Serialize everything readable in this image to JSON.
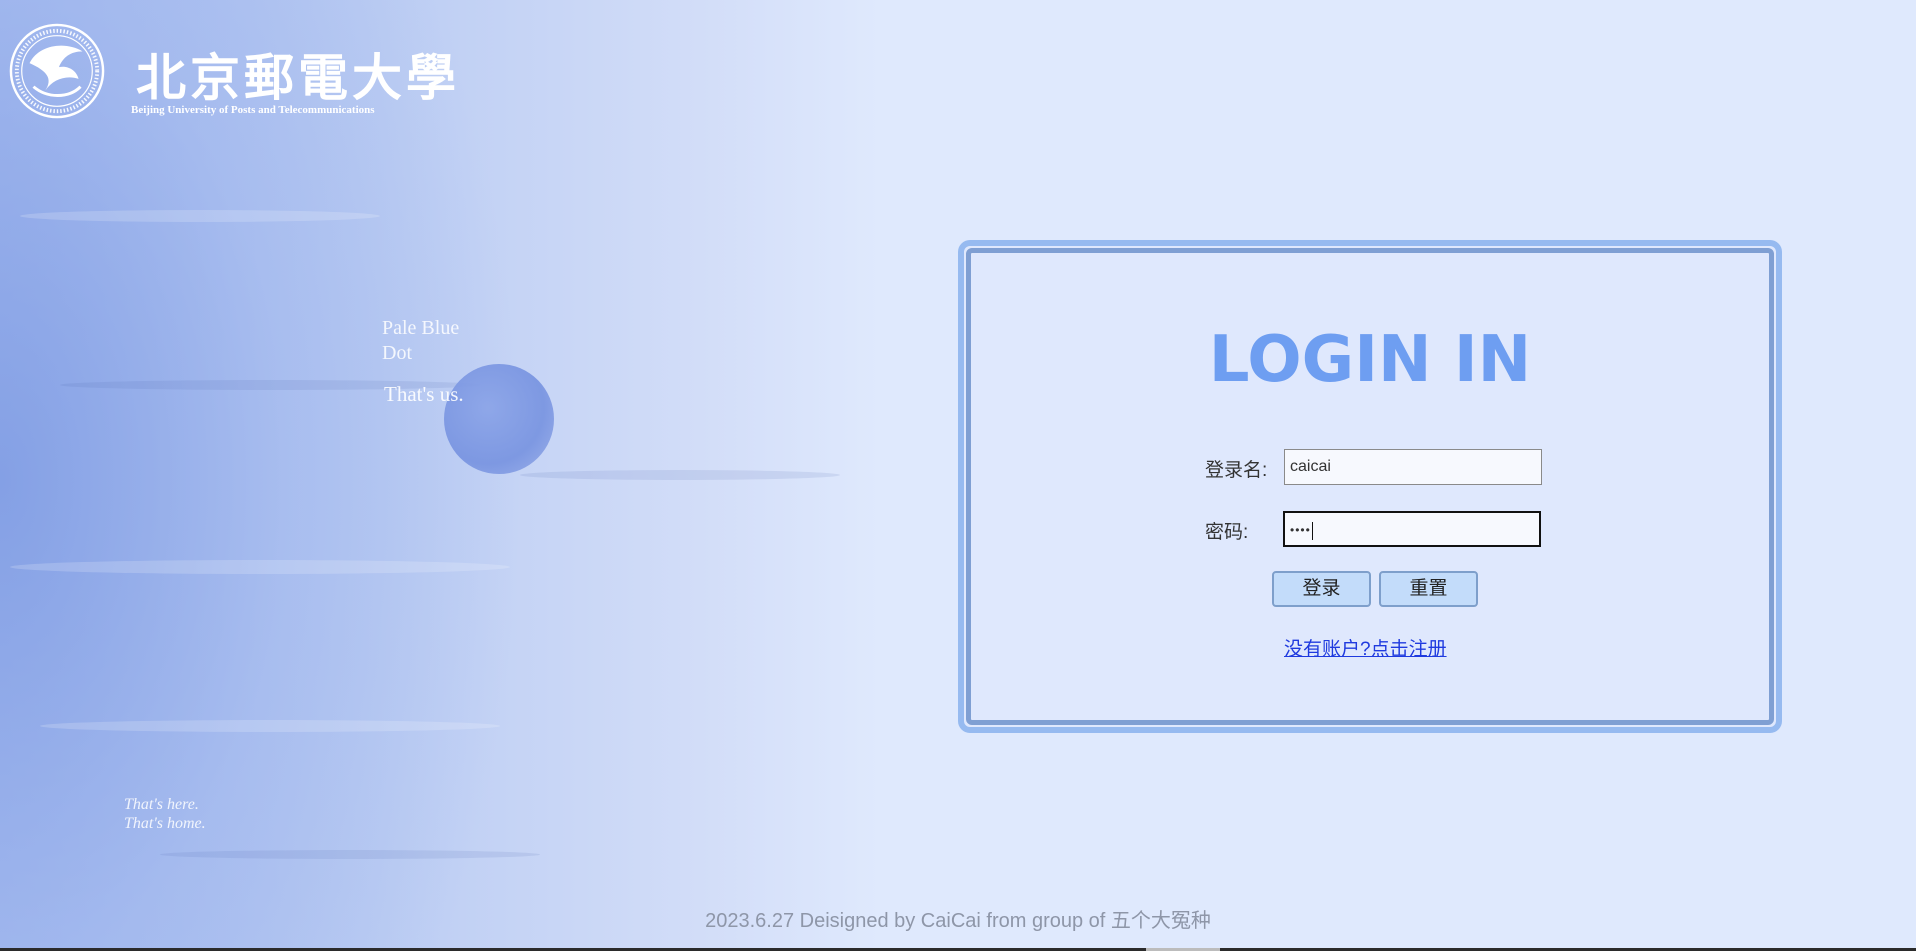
{
  "logo": {
    "name_cn": "北京郵電大學",
    "name_en": "Beijing University of Posts and Telecommunications"
  },
  "decor": {
    "pale_line1": "Pale Blue",
    "pale_line2": "Dot",
    "thats_us": "That's us.",
    "home_line1": "That's here.",
    "home_line2": "That's home."
  },
  "login": {
    "title": "LOGIN IN",
    "username_label": "登录名:",
    "username_value": "caicai",
    "password_label": "密码:",
    "password_masked": "••••",
    "login_button": "登录",
    "reset_button": "重置",
    "register_link": "没有账户?点击注册"
  },
  "footer": {
    "text": "2023.6.27 Deisigned by CaiCai from group of 五个大冤种"
  },
  "colors": {
    "title": "#6e9ef1",
    "panel_border_outer": "#96baf0",
    "panel_border_inner": "#7f9fd3",
    "button_bg": "#c3dcfa",
    "link": "#1f3adf"
  }
}
